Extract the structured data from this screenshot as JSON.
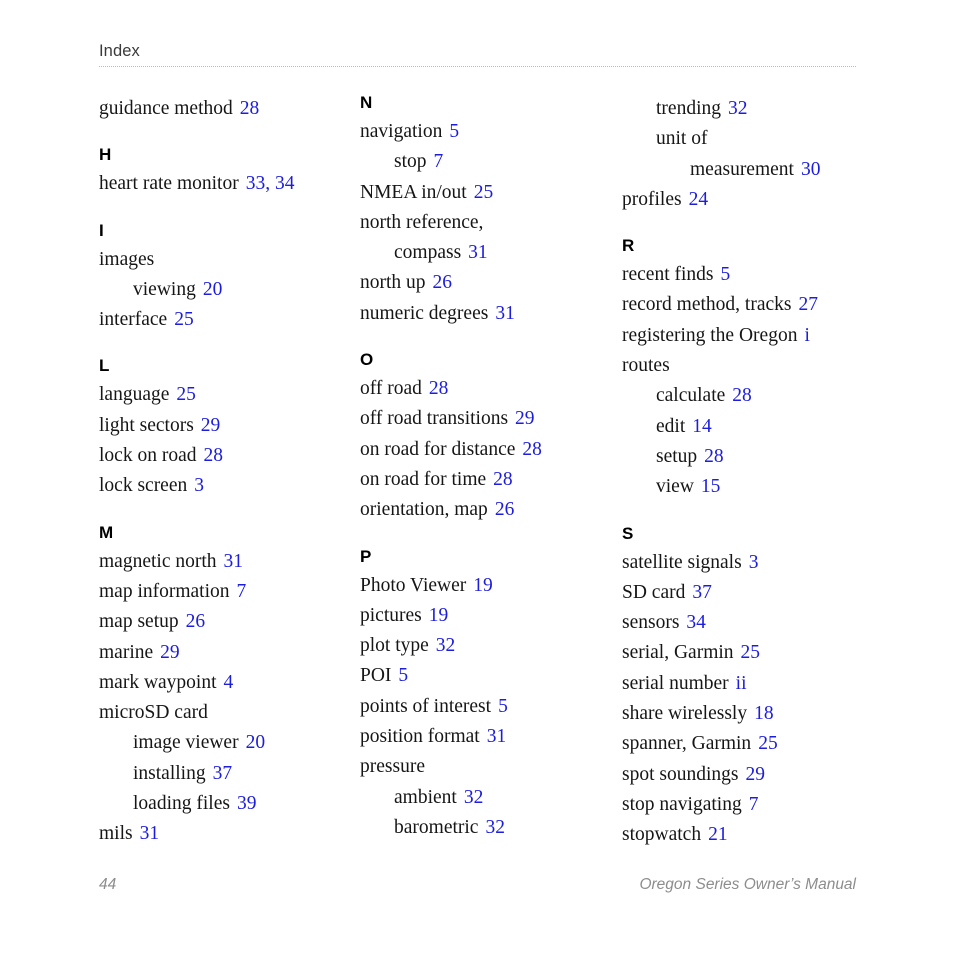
{
  "header": {
    "title": "Index"
  },
  "colors": {
    "page_number_link": "#1d1ddd",
    "body_text": "#161616",
    "footer_text": "#8d8d8d",
    "rule": "#b9b9b9"
  },
  "columns": [
    {
      "name": "column-1",
      "blocks": [
        {
          "heading": null,
          "entries": [
            {
              "term": "guidance method",
              "pages": "28",
              "level": 1
            }
          ]
        },
        {
          "heading": "H",
          "entries": [
            {
              "term": "heart rate monitor",
              "pages": "33, 34",
              "level": 1
            }
          ]
        },
        {
          "heading": "I",
          "entries": [
            {
              "term": "images",
              "pages": "",
              "level": 1
            },
            {
              "term": "viewing",
              "pages": "20",
              "level": 2
            },
            {
              "term": "interface",
              "pages": "25",
              "level": 1
            }
          ]
        },
        {
          "heading": "L",
          "entries": [
            {
              "term": "language",
              "pages": "25",
              "level": 1
            },
            {
              "term": "light sectors",
              "pages": "29",
              "level": 1
            },
            {
              "term": "lock on road",
              "pages": "28",
              "level": 1
            },
            {
              "term": "lock screen",
              "pages": "3",
              "level": 1
            }
          ]
        },
        {
          "heading": "M",
          "entries": [
            {
              "term": "magnetic north",
              "pages": "31",
              "level": 1
            },
            {
              "term": "map information",
              "pages": "7",
              "level": 1
            },
            {
              "term": "map setup",
              "pages": "26",
              "level": 1
            },
            {
              "term": "marine",
              "pages": "29",
              "level": 1
            },
            {
              "term": "mark waypoint",
              "pages": "4",
              "level": 1
            },
            {
              "term": "microSD card",
              "pages": "",
              "level": 1
            },
            {
              "term": "image viewer",
              "pages": "20",
              "level": 2
            },
            {
              "term": "installing",
              "pages": "37",
              "level": 2
            },
            {
              "term": "loading files",
              "pages": "39",
              "level": 2
            },
            {
              "term": "mils",
              "pages": "31",
              "level": 1
            }
          ]
        }
      ]
    },
    {
      "name": "column-2",
      "blocks": [
        {
          "heading": "N",
          "entries": [
            {
              "term": "navigation",
              "pages": "5",
              "level": 1
            },
            {
              "term": "stop",
              "pages": "7",
              "level": 2
            },
            {
              "term": "NMEA in/out",
              "pages": "25",
              "level": 1
            },
            {
              "term": "north reference,",
              "pages": "",
              "level": 1
            },
            {
              "term": "compass",
              "pages": "31",
              "level": 2
            },
            {
              "term": "north up",
              "pages": "26",
              "level": 1
            },
            {
              "term": "numeric degrees",
              "pages": "31",
              "level": 1
            }
          ]
        },
        {
          "heading": "O",
          "entries": [
            {
              "term": "off road",
              "pages": "28",
              "level": 1
            },
            {
              "term": "off road transitions",
              "pages": "29",
              "level": 1
            },
            {
              "term": "on road for distance",
              "pages": "28",
              "level": 1
            },
            {
              "term": "on road for time",
              "pages": "28",
              "level": 1
            },
            {
              "term": "orientation, map",
              "pages": "26",
              "level": 1
            }
          ]
        },
        {
          "heading": "P",
          "entries": [
            {
              "term": "Photo Viewer",
              "pages": "19",
              "level": 1
            },
            {
              "term": "pictures",
              "pages": "19",
              "level": 1
            },
            {
              "term": "plot type",
              "pages": "32",
              "level": 1
            },
            {
              "term": "POI",
              "pages": "5",
              "level": 1
            },
            {
              "term": "points of interest",
              "pages": "5",
              "level": 1
            },
            {
              "term": "position format",
              "pages": "31",
              "level": 1
            },
            {
              "term": "pressure",
              "pages": "",
              "level": 1
            },
            {
              "term": "ambient",
              "pages": "32",
              "level": 2
            },
            {
              "term": "barometric",
              "pages": "32",
              "level": 2
            }
          ]
        }
      ]
    },
    {
      "name": "column-3",
      "blocks": [
        {
          "heading": null,
          "entries": [
            {
              "term": "trending",
              "pages": "32",
              "level": 2
            },
            {
              "term": "unit of",
              "pages": "",
              "level": 2
            },
            {
              "term": "measurement",
              "pages": "30",
              "level": 3
            },
            {
              "term": "profiles",
              "pages": "24",
              "level": 1
            }
          ]
        },
        {
          "heading": "R",
          "entries": [
            {
              "term": "recent finds",
              "pages": "5",
              "level": 1
            },
            {
              "term": "record method, tracks",
              "pages": "27",
              "level": 1
            },
            {
              "term": "registering the Oregon",
              "pages": "i",
              "level": 1
            },
            {
              "term": "routes",
              "pages": "",
              "level": 1
            },
            {
              "term": "calculate",
              "pages": "28",
              "level": 2
            },
            {
              "term": "edit",
              "pages": "14",
              "level": 2
            },
            {
              "term": "setup",
              "pages": "28",
              "level": 2
            },
            {
              "term": "view",
              "pages": "15",
              "level": 2
            }
          ]
        },
        {
          "heading": "S",
          "entries": [
            {
              "term": "satellite signals",
              "pages": "3",
              "level": 1
            },
            {
              "term": "SD card",
              "pages": "37",
              "level": 1
            },
            {
              "term": "sensors",
              "pages": "34",
              "level": 1
            },
            {
              "term": "serial, Garmin",
              "pages": "25",
              "level": 1
            },
            {
              "term": "serial number",
              "pages": "ii",
              "level": 1
            },
            {
              "term": "share wirelessly",
              "pages": "18",
              "level": 1
            },
            {
              "term": "spanner, Garmin",
              "pages": "25",
              "level": 1
            },
            {
              "term": "spot soundings",
              "pages": "29",
              "level": 1
            },
            {
              "term": "stop navigating",
              "pages": "7",
              "level": 1
            },
            {
              "term": "stopwatch",
              "pages": "21",
              "level": 1
            }
          ]
        }
      ]
    }
  ],
  "footer": {
    "page_number": "44",
    "manual_title": "Oregon Series Owner’s Manual"
  }
}
